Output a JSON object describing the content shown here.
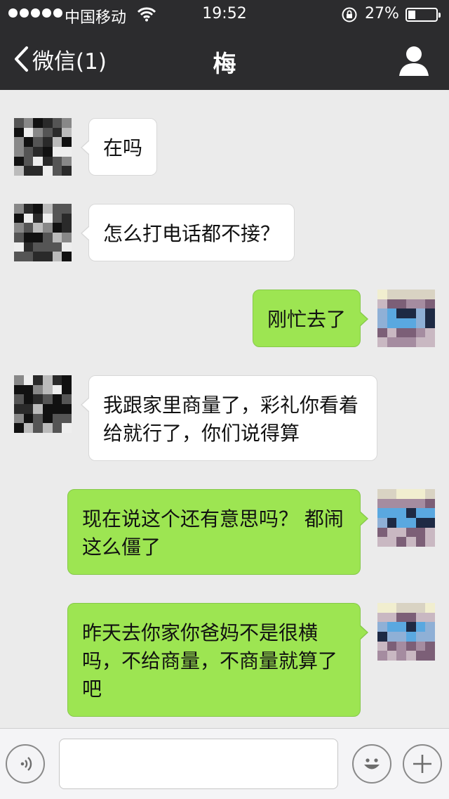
{
  "status_bar": {
    "carrier": "中国移动",
    "time": "19:52",
    "battery_percent_label": "27%",
    "battery_level": 0.27,
    "signal_bars": 5
  },
  "nav": {
    "back_label": "微信(1)",
    "title": "梅"
  },
  "messages": [
    {
      "side": "in",
      "text": "在吗"
    },
    {
      "side": "in",
      "text": "怎么打电话都不接？"
    },
    {
      "side": "out",
      "text": "刚忙去了"
    },
    {
      "side": "in",
      "text": "我跟家里商量了，彩礼你看着给就行了，你们说得算"
    },
    {
      "side": "out",
      "text": "现在说这个还有意思吗？ 都闹这么僵了"
    },
    {
      "side": "out",
      "text": "昨天去你家你爸妈不是很横吗，不给商量，不商量就算了吧"
    }
  ],
  "input": {
    "value": "",
    "placeholder": ""
  },
  "icons": {
    "back": "chevron-left-icon",
    "profile": "person-icon",
    "wifi": "wifi-icon",
    "lock": "rotation-lock-icon",
    "voice": "voice-icon",
    "emoji": "emoji-icon",
    "plus": "plus-icon"
  },
  "colors": {
    "header": "#2c2c2e",
    "background": "#ebebeb",
    "outgoing_bubble": "#9de552",
    "incoming_bubble": "#ffffff"
  }
}
